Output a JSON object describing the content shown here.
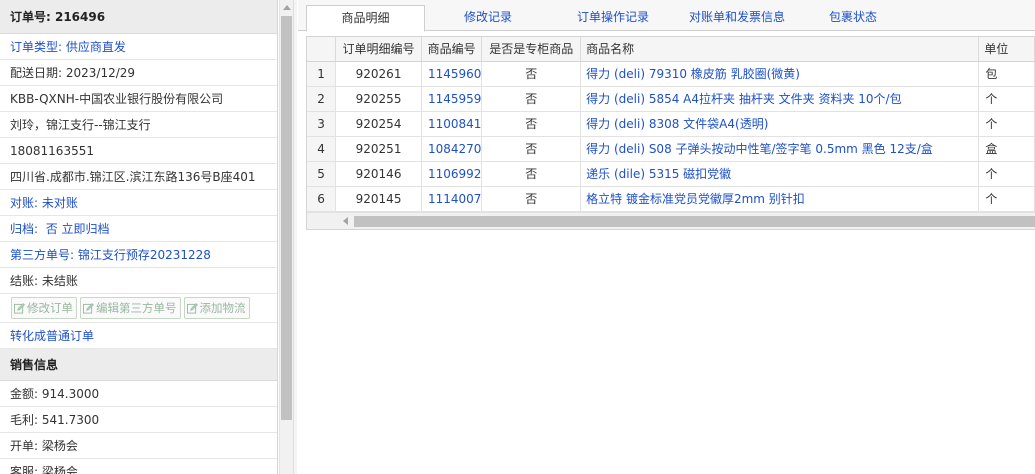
{
  "order": {
    "title": "订单号: 216496",
    "type": "订单类型: 供应商直发",
    "delivery_date": "配送日期: 2023/12/29",
    "company": "KBB-QXNH-中国农业银行股份有限公司",
    "contact": "刘玲，锦江支行--锦江支行",
    "phone": "18081163551",
    "address": "四川省.成都市.锦江区.滨江东路136号B座401",
    "reconcile": "对账: 未对账",
    "archive_label": "归档:",
    "archive_value": "否",
    "archive_link": "立即归档",
    "third_party_no": "第三方单号: 锦江支行预存20231228",
    "settlement": "结账: 未结账",
    "buttons": {
      "edit_order": "修改订单",
      "edit_third_party": "编辑第三方单号",
      "add_logistics": "添加物流"
    },
    "convert_link": "转化成普通订单"
  },
  "sales": {
    "title": "销售信息",
    "amount": "金额: 914.3000",
    "gross_profit": "毛利: 541.7300",
    "issuer": "开单: 梁杨会",
    "service": "客服: 梁杨会"
  },
  "tabs": [
    {
      "label": "商品明细"
    },
    {
      "label": "修改记录"
    },
    {
      "label": "订单操作记录"
    },
    {
      "label": "对账单和发票信息"
    },
    {
      "label": "包裹状态"
    }
  ],
  "table": {
    "headers": [
      "订单明细编号",
      "商品编号",
      "是否是专柜商品",
      "商品名称",
      "单位"
    ],
    "rows": [
      {
        "n": "1",
        "detail_id": "920261",
        "product_id": "1145960",
        "counter": "否",
        "name": "得力 (deli)  79310 橡皮筋 乳胶圈(微黄)",
        "unit": "包"
      },
      {
        "n": "2",
        "detail_id": "920255",
        "product_id": "1145959",
        "counter": "否",
        "name": "得力 (deli)  5854 A4拉杆夹 抽杆夹 文件夹 资料夹 10个/包",
        "unit": "个"
      },
      {
        "n": "3",
        "detail_id": "920254",
        "product_id": "1100841",
        "counter": "否",
        "name": "得力 (deli)  8308 文件袋A4(透明)",
        "unit": "个"
      },
      {
        "n": "4",
        "detail_id": "920251",
        "product_id": "1084270",
        "counter": "否",
        "name": "得力 (deli)  S08 子弹头按动中性笔/签字笔 0.5mm 黑色 12支/盒",
        "unit": "盒"
      },
      {
        "n": "5",
        "detail_id": "920146",
        "product_id": "1106992",
        "counter": "否",
        "name": "递乐 (dile)  5315 磁扣党徽",
        "unit": "个"
      },
      {
        "n": "6",
        "detail_id": "920145",
        "product_id": "1114007",
        "counter": "否",
        "name": "格立特 镀金标准党员党徽厚2mm 别针扣",
        "unit": "个"
      }
    ]
  }
}
